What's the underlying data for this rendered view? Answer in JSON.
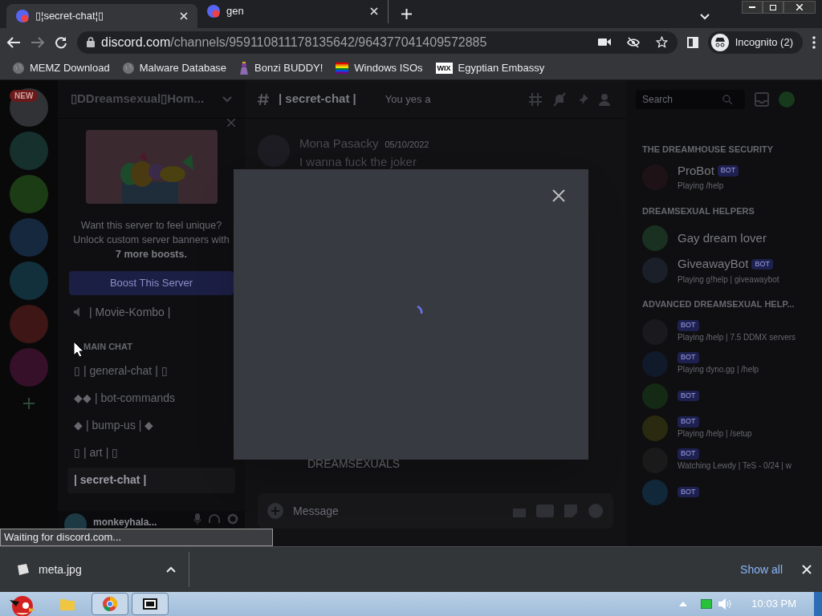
{
  "browser": {
    "tabs": [
      {
        "title": "▯¦secret-chat¦▯",
        "selected": true
      },
      {
        "title": "gen",
        "selected": false
      }
    ],
    "address": {
      "host": "discord.com",
      "path": "/channels/959110811178135642/964377041409572885"
    },
    "profile": "Incognito (2)",
    "bookmarks": [
      {
        "label": "MEMZ Download",
        "kind": "globe"
      },
      {
        "label": "Malware Database",
        "kind": "globe"
      },
      {
        "label": "Bonzi BUDDY!",
        "kind": "figure"
      },
      {
        "label": "Windows ISOs",
        "kind": "flag"
      },
      {
        "label": "Egyptian Embassy",
        "kind": "logo",
        "icon_text": "WIX"
      }
    ]
  },
  "discord": {
    "rail": {
      "badge": "NEW"
    },
    "server_name": "▯DDreamsexual▯Hom...",
    "boost_card": {
      "lines": [
        "Want this server to feel unique?",
        "Unlock custom server banners with"
      ],
      "highlight": "7 more boosts.",
      "button": "Boost This Server"
    },
    "voice_channel": "| Movie-Kombo |",
    "category": "MAIN CHAT",
    "channels": [
      {
        "name": "▯ | general-chat | ▯",
        "selected": false
      },
      {
        "name": "◆◆ | bot-commands",
        "selected": false
      },
      {
        "name": "◆ | bump-us | ◆",
        "selected": false
      },
      {
        "name": "▯ | art | ▯",
        "selected": false
      },
      {
        "name": "| secret-chat |",
        "selected": true
      }
    ],
    "user": "monkeyhala...",
    "chat_header": {
      "channel": "| secret-chat |",
      "topic": "You yes a"
    },
    "message": {
      "author": "Mona Pasacky",
      "date": "05/10/2022",
      "text": "I wanna fuck the joker"
    },
    "bottom_text": "DREAMSEXUALS",
    "message_input": {
      "placeholder": "Message"
    },
    "member_search": {
      "placeholder": "Search"
    },
    "member_groups": [
      {
        "title": "THE DREAMHOUSE SECURITY",
        "members": [
          {
            "name": "ProBot",
            "tag": "BOT",
            "status": "Playing /help"
          }
        ]
      },
      {
        "title": "DREAMSEXUAL HELPERS",
        "members": [
          {
            "name": "Gay dream lover"
          },
          {
            "name": "GiveawayBot",
            "tag": "BOT",
            "status": "Playing g!help | giveawaybot"
          }
        ]
      },
      {
        "title": "ADVANCED DREAMSEXUAL HELP...",
        "members": [
          {
            "tag": "BOT",
            "status": "Playing /help | 7.5 DDMX servers"
          },
          {
            "tag": "BOT",
            "status": "Playing dyno.gg | /help"
          },
          {
            "tag": "BOT"
          },
          {
            "tag": "BOT",
            "status": "Playing /help | /setup"
          },
          {
            "tag": "BOT",
            "status": "Watching Lewdy | TeS - 0/24 | w"
          },
          {
            "tag": "BOT"
          }
        ]
      }
    ]
  },
  "status_bubble": "Waiting for discord.com...",
  "downloads": {
    "file": "meta.jpg",
    "show_all": "Show all"
  },
  "taskbar": {
    "clock": "10:03 PM"
  }
}
